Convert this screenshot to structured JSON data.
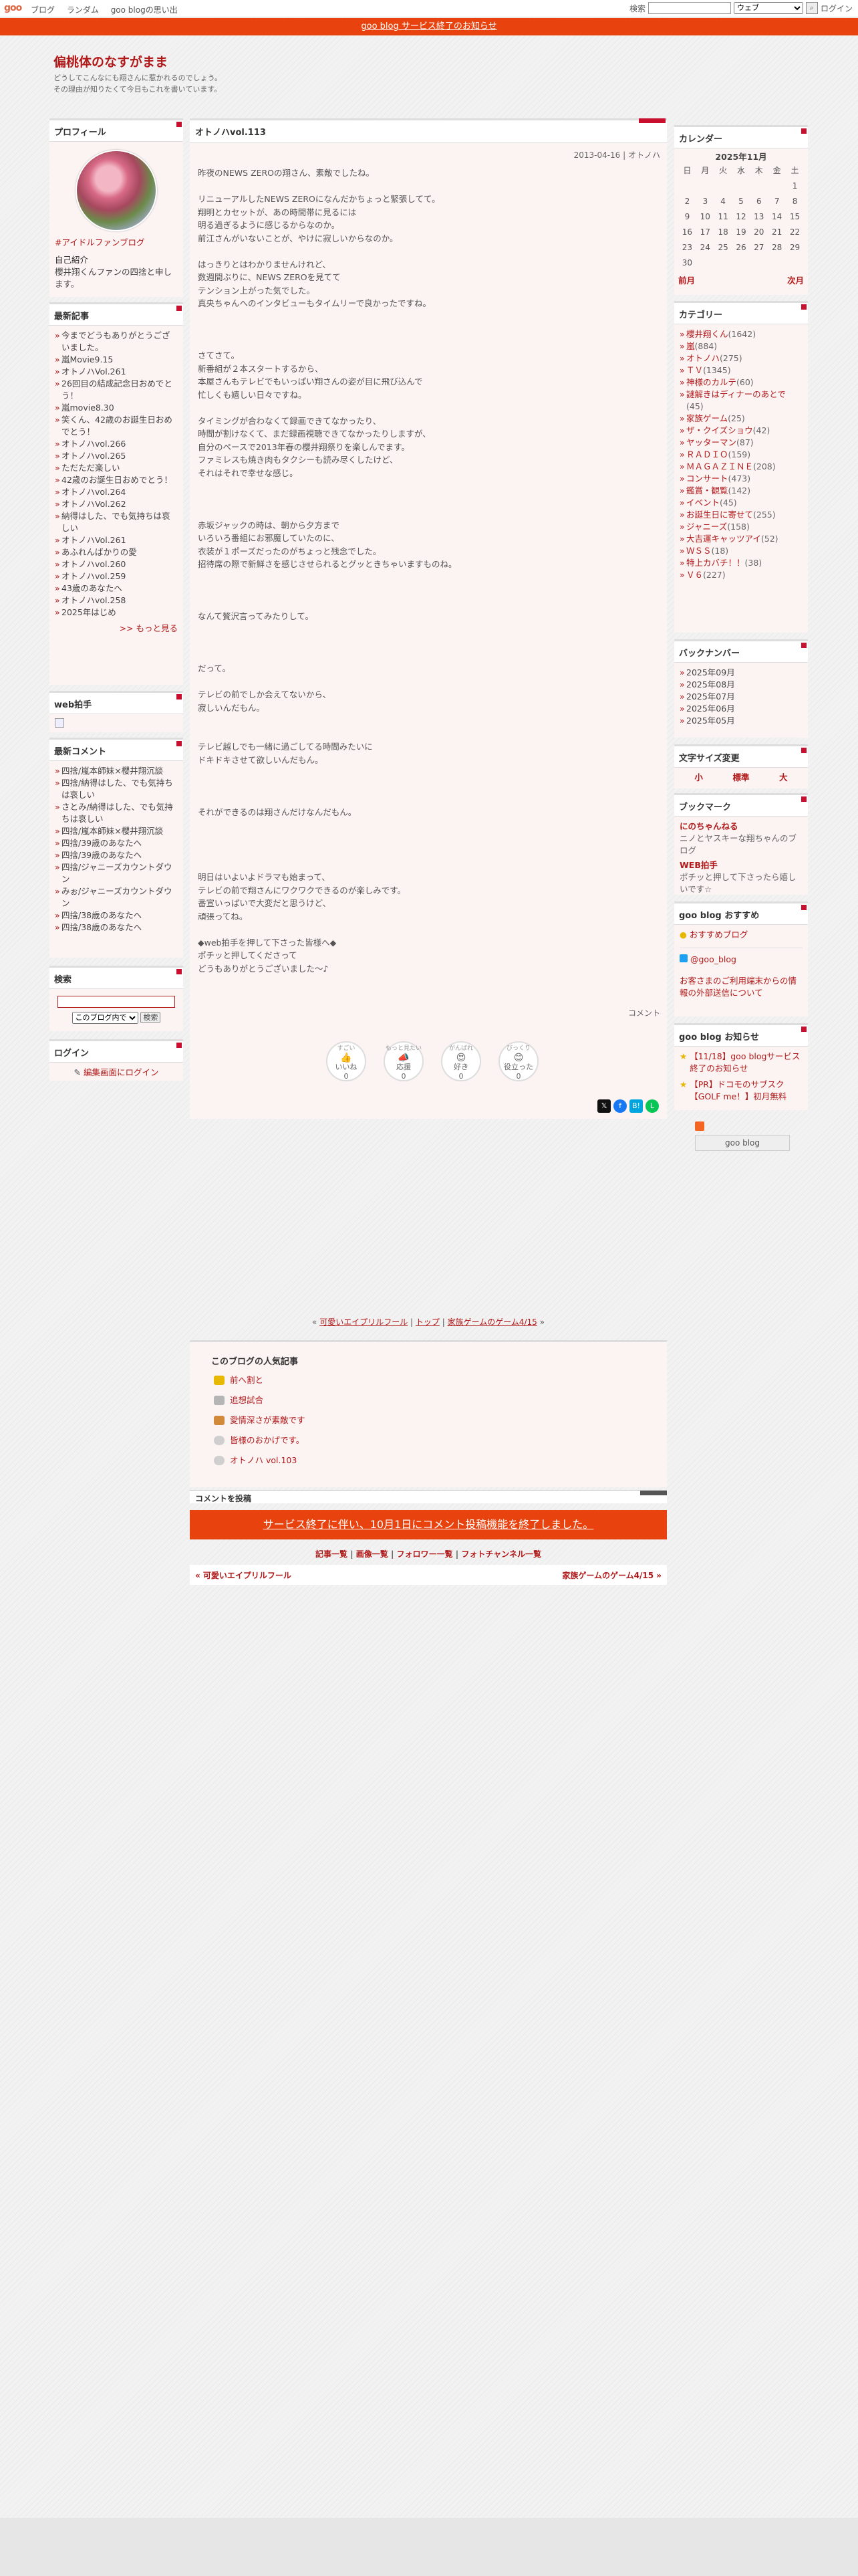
{
  "topbar": {
    "logo": "goo",
    "nav": [
      "ブログ",
      "ランダム",
      "goo blogの思い出"
    ],
    "search_label": "検索",
    "search_option": "ウェブ",
    "login": "ログイン"
  },
  "notice": "goo blog サービス終了のお知らせ",
  "blog": {
    "title": "偏桃体のなすがまま",
    "desc1": "どうしてこんなにも翔さんに惹かれるのでしょう。",
    "desc2": "その理由が知りたくて今日もこれを書いています。"
  },
  "profile": {
    "title": "プロフィール",
    "tag": "#アイドルファンブログ",
    "intro_label": "自己紹介",
    "intro": "櫻井翔くんファンの四捨と申します。"
  },
  "recent": {
    "title": "最新記事",
    "items": [
      "今までどうもありがとうございました。",
      "嵐Movie9.15",
      "オトノハVol.261",
      "26回目の結成記念日おめでとう！",
      "嵐movie8.30",
      "笑くん、42歳のお誕生日おめでとう！",
      "オトノハvol.266",
      "オトノハvol.265",
      "ただただ楽しい",
      "42歳のお誕生日おめでとう！",
      "オトノハvol.264",
      "オトノハVol.262",
      "納得はした、でも気持ちは哀しい",
      "オトノハVol.261",
      "あふれんばかりの愛",
      "オトノハvol.260",
      "オトノハvol.259",
      "43歳のあなたへ",
      "オトノハvol.258",
      "2025年はじめ"
    ],
    "more": ">> もっと見る"
  },
  "webclap": {
    "title": "web拍手"
  },
  "comments": {
    "title": "最新コメント",
    "items": [
      "四捨/嵐本師妹×櫻井翔沉談",
      "四捨/納得はした、でも気持ちは哀しい",
      "さとみ/納得はした、でも気持ちは哀しい",
      "四捨/嵐本師妹×櫻井翔沉談",
      "四捨/39歳のあなたへ",
      "四捨/39歳のあなたへ",
      "四捨/ジャニーズカウントダウン",
      "みぉ/ジャニーズカウントダウン",
      "四捨/38歳のあなたへ",
      "四捨/38歳のあなたへ"
    ]
  },
  "search": {
    "title": "検索",
    "option": "このブログ内で",
    "button": "検索"
  },
  "login": {
    "title": "ログイン",
    "link": "編集画面にログイン"
  },
  "post": {
    "title": "オトノハvol.113",
    "date": "2013-04-16 | オトノハ",
    "lines": [
      "昨夜のNEWS ZEROの翔さん、素敵でしたね。",
      "",
      "リニューアルしたNEWS ZEROになんだかちょっと緊張してて。",
      "翔明とカセットが、あの時間帯に見るには",
      "明る過ぎるように感じるからなのか。",
      "前江さんがいないことが、やけに寂しいからなのか。",
      "",
      "はっきりとはわかりませんけれど、",
      "数週間ぶりに、NEWS ZEROを見てて",
      "テンション上がった気でした。",
      "真央ちゃんへのインタビューもタイムリーで良かったですね。",
      "",
      "",
      "",
      "さてさて。",
      "新番組が２本スタートするから、",
      "本屋さんもテレビでもいっぱい翔さんの姿が目に飛び込んで",
      "忙しくも嬉しい日々ですね。",
      "",
      "タイミングが合わなくて録画できてなかったり、",
      "時間が割けなくて、まだ録画視聴できてなかったりしますが、",
      "自分のペースで2013年春の櫻井翔祭りを楽しんでます。",
      "ファミレスも焼き肉もタクシーも読み尽くしたけど、",
      "それはそれで幸せな感じ。",
      "",
      "",
      "",
      "赤坂ジャックの時は、朝から夕方まで",
      "いろいろ番組にお邪魔していたのに、",
      "衣装が１ポーズだったのがちょっと残念でした。",
      "招待席の際で新鮮さを感じさせられるとグッときちゃいますものね。",
      "",
      "",
      "",
      "なんて贅沢言ってみたりして。",
      "",
      "",
      "",
      "だって。",
      "",
      "テレビの前でしか会えてないから、",
      "寂しいんだもん。",
      "",
      "",
      "テレビ越しでも一緒に過ごしてる時間みたいに",
      "ドキドキさせて欲しいんだもん。",
      "",
      "",
      "",
      "それができるのは翔さんだけなんだもん。",
      "",
      "",
      "",
      "",
      "明日はいよいよドラマも始まって、",
      "テレビの前で翔さんにワクワクできるのが楽しみです。",
      "番宣いっぱいで大変だと思うけど、",
      "頑張ってね。",
      "",
      "◆web拍手を押して下さった皆様へ◆",
      "ポチッと押してくださって",
      "どうもありがとうございました〜♪"
    ],
    "comment_link": "コメント"
  },
  "reactions": [
    {
      "top": "すごい",
      "label": "いいね",
      "count": "0"
    },
    {
      "top": "もっと見たい",
      "label": "応援",
      "count": "0"
    },
    {
      "top": "がんばれ",
      "label": "好き",
      "count": "0"
    },
    {
      "top": "びっくり",
      "label": "役立った",
      "count": "0"
    }
  ],
  "calendar": {
    "title": "カレンダー",
    "month": "2025年11月",
    "days": [
      "日",
      "月",
      "火",
      "水",
      "木",
      "金",
      "土"
    ],
    "weeks": [
      [
        "",
        "",
        "",
        "",
        "",
        "",
        "1"
      ],
      [
        "2",
        "3",
        "4",
        "5",
        "6",
        "7",
        "8"
      ],
      [
        "9",
        "10",
        "11",
        "12",
        "13",
        "14",
        "15"
      ],
      [
        "16",
        "17",
        "18",
        "19",
        "20",
        "21",
        "22"
      ],
      [
        "23",
        "24",
        "25",
        "26",
        "27",
        "28",
        "29"
      ],
      [
        "30",
        "",
        "",
        "",
        "",
        "",
        ""
      ]
    ],
    "prev": "前月",
    "next": "次月"
  },
  "categories": {
    "title": "カテゴリー",
    "items": [
      [
        "櫻井翔くん",
        "(1642)"
      ],
      [
        "嵐",
        "(884)"
      ],
      [
        "オトノハ",
        "(275)"
      ],
      [
        "ＴＶ",
        "(1345)"
      ],
      [
        "神様のカルテ",
        "(60)"
      ],
      [
        "謎解きはディナーのあとで",
        "(45)"
      ],
      [
        "家族ゲーム",
        "(25)"
      ],
      [
        "ザ・クイズショウ",
        "(42)"
      ],
      [
        "ヤッターマン",
        "(87)"
      ],
      [
        "ＲＡＤＩＯ",
        "(159)"
      ],
      [
        "ＭＡＧＡＺＩＮＥ",
        "(208)"
      ],
      [
        "コンサート",
        "(473)"
      ],
      [
        "鑑賞・観覧",
        "(142)"
      ],
      [
        "イベント",
        "(45)"
      ],
      [
        "お誕生日に寄せて",
        "(255)"
      ],
      [
        "ジャニーズ",
        "(158)"
      ],
      [
        "大吉運キャッツアイ",
        "(52)"
      ],
      [
        "ＷＳＳ",
        "(18)"
      ],
      [
        "特上カバチ！！",
        "(38)"
      ],
      [
        "Ｖ６",
        "(227)"
      ]
    ]
  },
  "backnumber": {
    "title": "バックナンバー",
    "items": [
      "2025年09月",
      "2025年08月",
      "2025年07月",
      "2025年06月",
      "2025年05月"
    ]
  },
  "fontsize": {
    "title": "文字サイズ変更",
    "items": [
      "小",
      "標準",
      "大"
    ]
  },
  "bookmark": {
    "title": "ブックマーク",
    "items": [
      {
        "name": "にのちゃんねる",
        "desc": "ニノとヤスキーな翔ちゃんのブログ"
      },
      {
        "name": "WEB拍手",
        "desc": "ポチッと押して下さったら嬉しいです☆"
      }
    ]
  },
  "recommend": {
    "title": "goo blog おすすめ",
    "items": [
      "おすすめブログ",
      "@goo_blog"
    ],
    "note": "お客さまのご利用端末からの情報の外部送信について"
  },
  "gooinfo": {
    "title": "goo blog お知らせ",
    "items": [
      "【11/18】goo blogサービス終了のお知らせ",
      "【PR】ドコモのサブスク【GOLF me！】初月無料"
    ]
  },
  "footer": {
    "goo_button": "goo blog",
    "pager": [
      "« ",
      "可愛いエイプリルフール",
      " | ",
      "トップ",
      " | ",
      "家族ゲームのゲーム4/15",
      " »"
    ]
  },
  "popular": {
    "title": "このブログの人気記事",
    "items": [
      "前へ割と",
      "追想試合",
      "愛情深さが素敵です",
      "皆様のおかげです。",
      "オトノハ vol.103"
    ]
  },
  "comment_post": {
    "title": "コメントを投稿",
    "notice": "サービス終了に伴い、10月1日にコメント投稿機能を終了しました。"
  },
  "footlinks": [
    "記事一覧",
    "画像一覧",
    "フォロワー一覧",
    "フォトチャンネル一覧"
  ],
  "prevnext": {
    "prev": "« 可愛いエイプリルフール",
    "next": "家族ゲームのゲーム4/15 »"
  }
}
